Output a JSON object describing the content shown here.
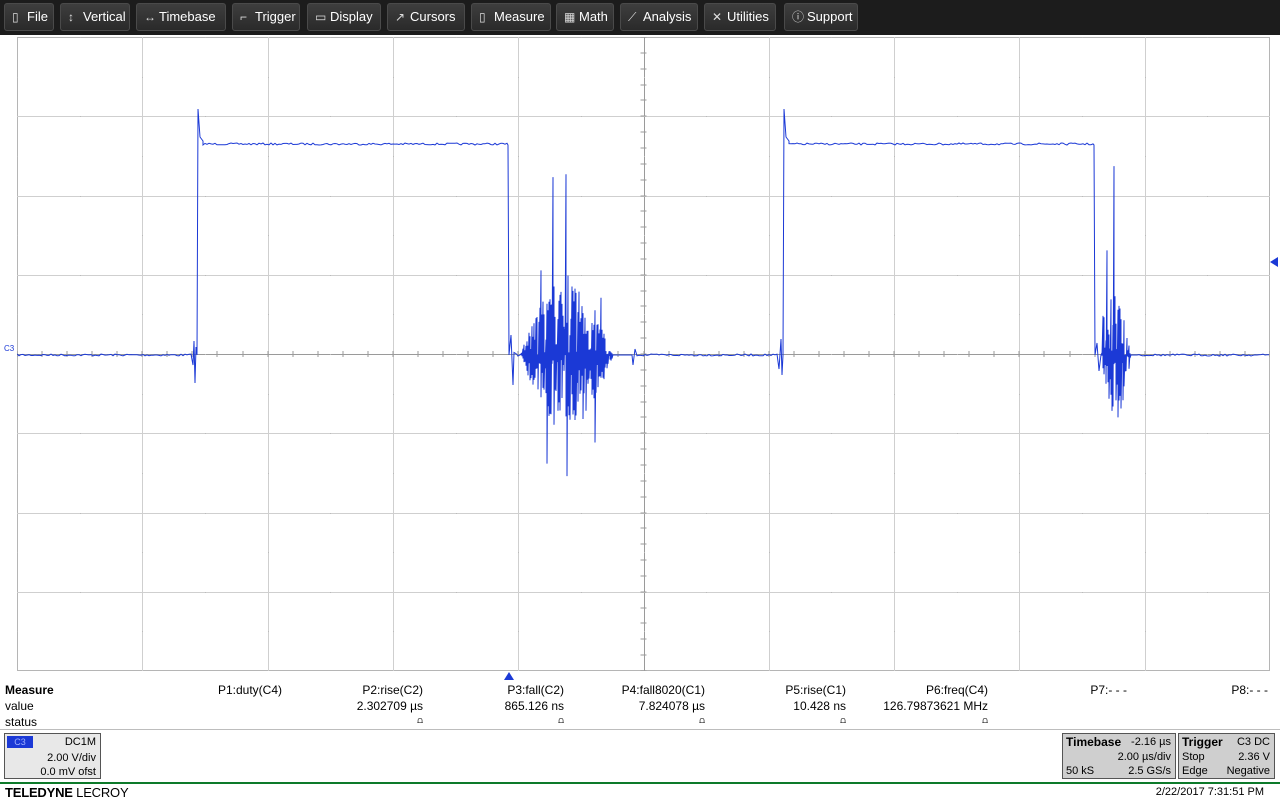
{
  "menu": [
    {
      "label": "File",
      "icon": "clipboard-icon",
      "glyph": "▯"
    },
    {
      "label": "Vertical",
      "icon": "vertical-arrows-icon",
      "glyph": "↕"
    },
    {
      "label": "Timebase",
      "icon": "horizontal-arrows-icon",
      "glyph": "↔"
    },
    {
      "label": "Trigger",
      "icon": "trigger-edge-icon",
      "glyph": "⌐"
    },
    {
      "label": "Display",
      "icon": "display-icon",
      "glyph": "▭"
    },
    {
      "label": "Cursors",
      "icon": "cursor-icon",
      "glyph": "↗"
    },
    {
      "label": "Measure",
      "icon": "measure-icon",
      "glyph": "▯"
    },
    {
      "label": "Math",
      "icon": "calculator-icon",
      "glyph": "▦"
    },
    {
      "label": "Analysis",
      "icon": "analysis-chart-icon",
      "glyph": "⟋"
    },
    {
      "label": "Utilities",
      "icon": "tools-icon",
      "glyph": "✕"
    },
    {
      "label": "Support",
      "icon": "info-icon",
      "glyph": "ⓘ"
    }
  ],
  "channel_marker": "C3",
  "trace_color": "#1b39d6",
  "measure": {
    "title": "Measure",
    "row_labels": {
      "value": "value",
      "status": "status"
    },
    "params": [
      {
        "name": "P1:duty(C4)",
        "value": "",
        "status": ""
      },
      {
        "name": "P2:rise(C2)",
        "value": "2.302709 µs",
        "status": "⩍"
      },
      {
        "name": "P3:fall(C2)",
        "value": "865.126 ns",
        "status": "⩍"
      },
      {
        "name": "P4:fall8020(C1)",
        "value": "7.824078 µs",
        "status": "⩍"
      },
      {
        "name": "P5:rise(C1)",
        "value": "10.428 ns",
        "status": "⩍"
      },
      {
        "name": "P6:freq(C4)",
        "value": "126.79873621 MHz",
        "status": "⩍"
      },
      {
        "name": "P7:- - -",
        "value": "",
        "status": ""
      },
      {
        "name": "P8:- - -",
        "value": "",
        "status": ""
      }
    ]
  },
  "channel_box": {
    "tag": "C3",
    "coupling": "DC1M",
    "vdiv": "2.00 V/div",
    "offset": "0.0 mV ofst"
  },
  "timebase": {
    "title": "Timebase",
    "delay": "-2.16 µs",
    "tdiv": "2.00 µs/div",
    "samples": "50 kS",
    "rate": "2.5 GS/s"
  },
  "trigger": {
    "title": "Trigger",
    "source": "C3 DC",
    "mode": "Stop",
    "level": "2.36 V",
    "type": "Edge",
    "slope": "Negative"
  },
  "brand": {
    "bold": "TELEDYNE",
    "light": " LECROY"
  },
  "datetime": "2/22/2017 7:31:51 PM"
}
